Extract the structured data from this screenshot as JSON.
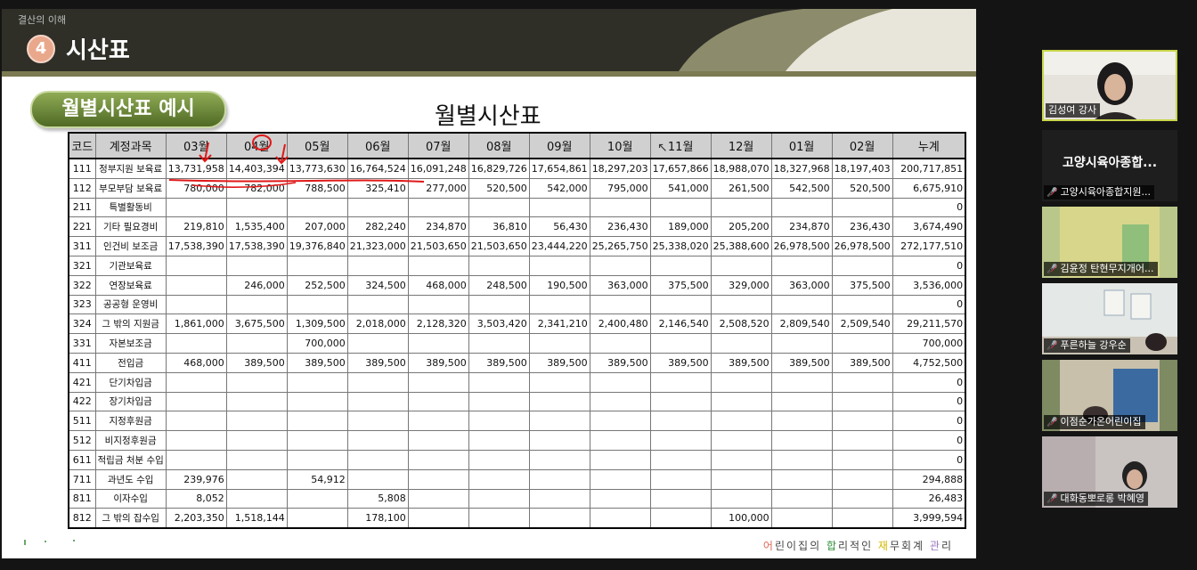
{
  "slide": {
    "section_label": "결산의 이해",
    "number": "4",
    "title": "시산표",
    "example_badge": "월별시산표 예시",
    "table_title": "월별시산표",
    "footer": [
      "어",
      "린이집의 ",
      "합",
      "리적인 ",
      "재",
      "무회계 ",
      "관",
      "리"
    ],
    "columns": [
      "코드",
      "계정과목",
      "03월",
      "04월",
      "05월",
      "06월",
      "07월",
      "08월",
      "09월",
      "10월",
      "11월",
      "12월",
      "01월",
      "02월",
      "누계"
    ],
    "rows": [
      {
        "code": "111",
        "account": "정부지원 보육료",
        "values": [
          "13,731,958",
          "14,403,394",
          "13,773,630",
          "16,764,524",
          "16,091,248",
          "16,829,726",
          "17,654,861",
          "18,297,203",
          "17,657,866",
          "18,988,070",
          "18,327,968",
          "18,197,403",
          "200,717,851"
        ]
      },
      {
        "code": "112",
        "account": "부모부담 보육료",
        "values": [
          "780,000",
          "782,000",
          "788,500",
          "325,410",
          "277,000",
          "520,500",
          "542,000",
          "795,000",
          "541,000",
          "261,500",
          "542,500",
          "520,500",
          "6,675,910"
        ]
      },
      {
        "code": "211",
        "account": "특별활동비",
        "values": [
          "",
          "",
          "",
          "",
          "",
          "",
          "",
          "",
          "",
          "",
          "",
          "",
          "0"
        ]
      },
      {
        "code": "221",
        "account": "기타 필요경비",
        "values": [
          "219,810",
          "1,535,400",
          "207,000",
          "282,240",
          "234,870",
          "36,810",
          "56,430",
          "236,430",
          "189,000",
          "205,200",
          "234,870",
          "236,430",
          "3,674,490"
        ]
      },
      {
        "code": "311",
        "account": "인건비 보조금",
        "values": [
          "17,538,390",
          "17,538,390",
          "19,376,840",
          "21,323,000",
          "21,503,650",
          "21,503,650",
          "23,444,220",
          "25,265,750",
          "25,338,020",
          "25,388,600",
          "26,978,500",
          "26,978,500",
          "272,177,510"
        ]
      },
      {
        "code": "321",
        "account": "기관보육료",
        "values": [
          "",
          "",
          "",
          "",
          "",
          "",
          "",
          "",
          "",
          "",
          "",
          "",
          "0"
        ]
      },
      {
        "code": "322",
        "account": "연장보육료",
        "values": [
          "",
          "246,000",
          "252,500",
          "324,500",
          "468,000",
          "248,500",
          "190,500",
          "363,000",
          "375,500",
          "329,000",
          "363,000",
          "375,500",
          "3,536,000"
        ]
      },
      {
        "code": "323",
        "account": "공공형 운영비",
        "values": [
          "",
          "",
          "",
          "",
          "",
          "",
          "",
          "",
          "",
          "",
          "",
          "",
          "0"
        ]
      },
      {
        "code": "324",
        "account": "그 밖의 지원금",
        "values": [
          "1,861,000",
          "3,675,500",
          "1,309,500",
          "2,018,000",
          "2,128,320",
          "3,503,420",
          "2,341,210",
          "2,400,480",
          "2,146,540",
          "2,508,520",
          "2,809,540",
          "2,509,540",
          "29,211,570"
        ]
      },
      {
        "code": "331",
        "account": "자본보조금",
        "values": [
          "",
          "",
          "700,000",
          "",
          "",
          "",
          "",
          "",
          "",
          "",
          "",
          "",
          "700,000"
        ]
      },
      {
        "code": "411",
        "account": "전입금",
        "values": [
          "468,000",
          "389,500",
          "389,500",
          "389,500",
          "389,500",
          "389,500",
          "389,500",
          "389,500",
          "389,500",
          "389,500",
          "389,500",
          "389,500",
          "4,752,500"
        ]
      },
      {
        "code": "421",
        "account": "단기차입금",
        "values": [
          "",
          "",
          "",
          "",
          "",
          "",
          "",
          "",
          "",
          "",
          "",
          "",
          "0"
        ]
      },
      {
        "code": "422",
        "account": "장기차입금",
        "values": [
          "",
          "",
          "",
          "",
          "",
          "",
          "",
          "",
          "",
          "",
          "",
          "",
          "0"
        ]
      },
      {
        "code": "511",
        "account": "지정후원금",
        "values": [
          "",
          "",
          "",
          "",
          "",
          "",
          "",
          "",
          "",
          "",
          "",
          "",
          "0"
        ]
      },
      {
        "code": "512",
        "account": "비지정후원금",
        "values": [
          "",
          "",
          "",
          "",
          "",
          "",
          "",
          "",
          "",
          "",
          "",
          "",
          "0"
        ]
      },
      {
        "code": "611",
        "account": "적립금 처분 수입",
        "values": [
          "",
          "",
          "",
          "",
          "",
          "",
          "",
          "",
          "",
          "",
          "",
          "",
          "0"
        ]
      },
      {
        "code": "711",
        "account": "과년도 수입",
        "values": [
          "239,976",
          "",
          "54,912",
          "",
          "",
          "",
          "",
          "",
          "",
          "",
          "",
          "",
          "294,888"
        ]
      },
      {
        "code": "811",
        "account": "이자수입",
        "values": [
          "8,052",
          "",
          "",
          "5,808",
          "",
          "",
          "",
          "",
          "",
          "",
          "",
          "",
          "26,483"
        ]
      },
      {
        "code": "812",
        "account": "그 밖의 잡수입",
        "values": [
          "2,203,350",
          "1,518,144",
          "",
          "178,100",
          "",
          "",
          "",
          "",
          "",
          "100,000",
          "",
          "",
          "3,999,594"
        ]
      }
    ]
  },
  "participants": [
    {
      "name": "김성여 강사",
      "muted": false,
      "kind": "video"
    },
    {
      "name": "고양시육아종합지원...",
      "display": "고양시육아종합...",
      "muted": true,
      "kind": "name"
    },
    {
      "name": "김윤정 탄현무지개어...",
      "muted": true,
      "kind": "video"
    },
    {
      "name": "푸른하늘 강우순",
      "muted": true,
      "kind": "video"
    },
    {
      "name": "이점순가온어린이집",
      "muted": true,
      "kind": "video"
    },
    {
      "name": "대화동뽀로롱 박혜영",
      "muted": true,
      "kind": "video"
    }
  ],
  "colors": {
    "header_bg": "#2f2f28",
    "accent_line": "#7c7a52",
    "badge_green": "#6b8a3a",
    "annotation_red": "#e01818"
  },
  "icons": {
    "mute": "mic-muted-icon",
    "cursor": "mouse-pointer-icon"
  }
}
